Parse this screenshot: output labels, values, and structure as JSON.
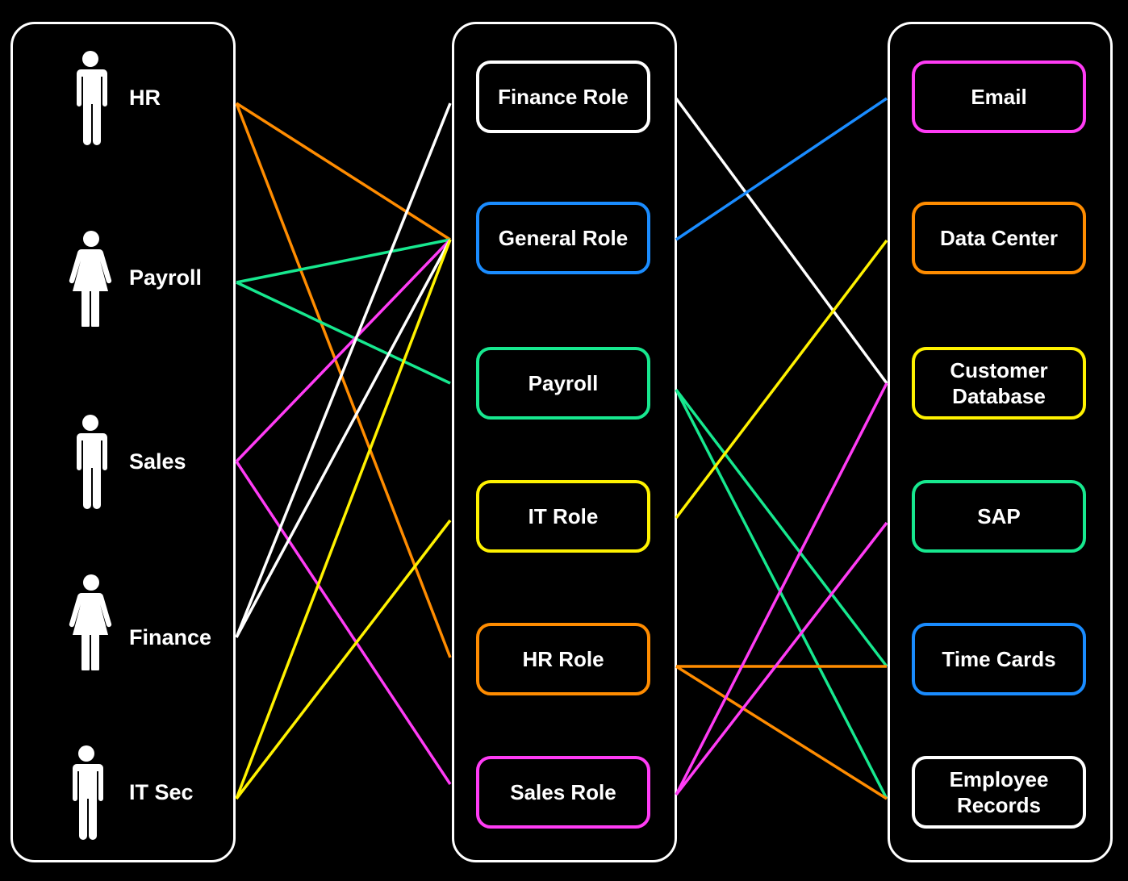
{
  "colors": {
    "white": "#ffffff",
    "blue": "#1a8cff",
    "green": "#17e88f",
    "yellow": "#fff200",
    "orange": "#ff8c00",
    "magenta": "#ff3cf5"
  },
  "users": [
    {
      "id": "hr",
      "label": "HR",
      "icon": "man-icon",
      "color": "orange"
    },
    {
      "id": "payroll",
      "label": "Payroll",
      "icon": "woman-icon",
      "color": "green"
    },
    {
      "id": "sales",
      "label": "Sales",
      "icon": "man-icon",
      "color": "magenta"
    },
    {
      "id": "finance",
      "label": "Finance",
      "icon": "woman-icon",
      "color": "white"
    },
    {
      "id": "itsec",
      "label": "IT Sec",
      "icon": "man-icon",
      "color": "yellow"
    }
  ],
  "roles": [
    {
      "id": "finance-role",
      "label": "Finance Role",
      "color": "white"
    },
    {
      "id": "general-role",
      "label": "General Role",
      "color": "blue"
    },
    {
      "id": "payroll-role",
      "label": "Payroll",
      "color": "green"
    },
    {
      "id": "it-role",
      "label": "IT Role",
      "color": "yellow"
    },
    {
      "id": "hr-role",
      "label": "HR Role",
      "color": "orange"
    },
    {
      "id": "sales-role",
      "label": "Sales Role",
      "color": "magenta"
    }
  ],
  "resources": [
    {
      "id": "email",
      "label": "Email",
      "color": "magenta"
    },
    {
      "id": "data-center",
      "label": "Data Center",
      "color": "orange"
    },
    {
      "id": "customer-database",
      "label": "Customer\nDatabase",
      "color": "yellow"
    },
    {
      "id": "sap",
      "label": "SAP",
      "color": "green"
    },
    {
      "id": "time-cards",
      "label": "Time Cards",
      "color": "blue"
    },
    {
      "id": "employee-records",
      "label": "Employee\nRecords",
      "color": "white"
    }
  ],
  "user_role_links": [
    {
      "from": "hr",
      "to": "general-role",
      "color": "orange"
    },
    {
      "from": "hr",
      "to": "hr-role",
      "color": "orange"
    },
    {
      "from": "payroll",
      "to": "general-role",
      "color": "green"
    },
    {
      "from": "payroll",
      "to": "payroll-role",
      "color": "green"
    },
    {
      "from": "sales",
      "to": "general-role",
      "color": "magenta"
    },
    {
      "from": "sales",
      "to": "sales-role",
      "color": "magenta"
    },
    {
      "from": "finance",
      "to": "finance-role",
      "color": "white"
    },
    {
      "from": "finance",
      "to": "general-role",
      "color": "white"
    },
    {
      "from": "itsec",
      "to": "general-role",
      "color": "yellow"
    },
    {
      "from": "itsec",
      "to": "it-role",
      "color": "yellow"
    }
  ],
  "role_resource_links": [
    {
      "from": "finance-role",
      "to": "customer-database",
      "color": "white"
    },
    {
      "from": "general-role",
      "to": "email",
      "color": "blue"
    },
    {
      "from": "payroll-role",
      "to": "time-cards",
      "color": "green"
    },
    {
      "from": "payroll-role",
      "to": "employee-records",
      "color": "green"
    },
    {
      "from": "it-role",
      "to": "data-center",
      "color": "yellow"
    },
    {
      "from": "hr-role",
      "to": "time-cards",
      "color": "orange"
    },
    {
      "from": "hr-role",
      "to": "employee-records",
      "color": "orange"
    },
    {
      "from": "sales-role",
      "to": "customer-database",
      "color": "magenta"
    },
    {
      "from": "sales-role",
      "to": "sap",
      "color": "magenta"
    }
  ]
}
